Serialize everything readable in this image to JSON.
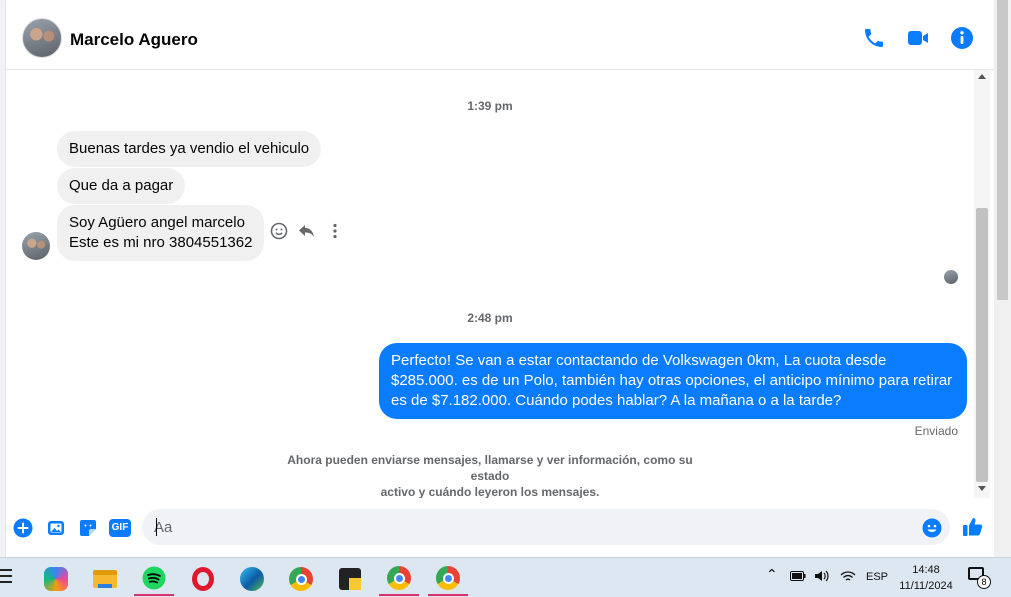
{
  "header": {
    "contact_name": "Marcelo Aguero",
    "icons": [
      "phone-icon",
      "video-call-icon",
      "info-icon"
    ]
  },
  "chat": {
    "timestamps": [
      "1:39 pm",
      "2:48 pm"
    ],
    "incoming": [
      "Buenas tardes ya vendio el vehiculo",
      "Que da a pagar",
      "Soy Agüero angel marcelo",
      "Este es mi nro 3804551362"
    ],
    "outgoing": "Perfecto!  Se van a estar contactando de Volkswagen 0km, La cuota desde $285.000. es de un Polo, también hay otras opciones, el anticipo mínimo para retirar es de $7.182.000. Cuándo podes hablar? A la mañana o a la tarde?",
    "sent_status": "Enviado",
    "info_line1": "Ahora pueden enviarse mensajes, llamarse y ver información, como su estado",
    "info_line2": "activo y cuándo leyeron los mensajes.",
    "message_actions": [
      "react-icon",
      "reply-icon",
      "more-icon"
    ]
  },
  "composer": {
    "placeholder": "Aa",
    "gif_label": "GIF",
    "icons": [
      "add-icon",
      "photo-icon",
      "sticker-icon",
      "gif-icon",
      "emoji-icon",
      "like-icon"
    ]
  },
  "taskbar": {
    "apps": [
      "copilot",
      "file-explorer",
      "spotify",
      "opera",
      "edge",
      "chrome",
      "sticky-notes",
      "chrome-profile-1",
      "chrome-profile-2"
    ],
    "language": "ESP",
    "time": "14:48",
    "date": "11/11/2024",
    "notification_count": "8"
  },
  "colors": {
    "accent": "#0a7cff",
    "incoming_bubble": "#f0f0f0"
  }
}
